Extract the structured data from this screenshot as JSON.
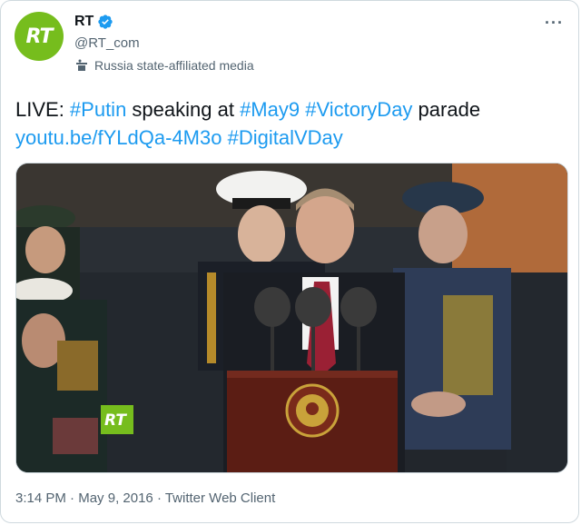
{
  "author": {
    "avatar_text": "RT",
    "display_name": "RT",
    "handle": "@RT_com",
    "affiliation": "Russia state-affiliated media"
  },
  "tweet": {
    "prefix": "LIVE: ",
    "hashtag_putin": "#Putin",
    "mid": " speaking at ",
    "hashtag_may9": "#May9",
    "space1": " ",
    "hashtag_victoryday": "#VictoryDay",
    "suffix": " parade",
    "link": "youtu.be/fYLdQa-4M3o",
    "space2": " ",
    "hashtag_digital": "#DigitalVDay"
  },
  "media": {
    "watermark": "RT"
  },
  "footer": {
    "time": "3:14 PM",
    "sep1": " · ",
    "date": "May 9, 2016",
    "sep2": " · ",
    "client": "Twitter Web Client"
  },
  "colors": {
    "link": "#1d9bf0",
    "rt_green": "#76bd1d",
    "verified": "#1d9bf0"
  }
}
